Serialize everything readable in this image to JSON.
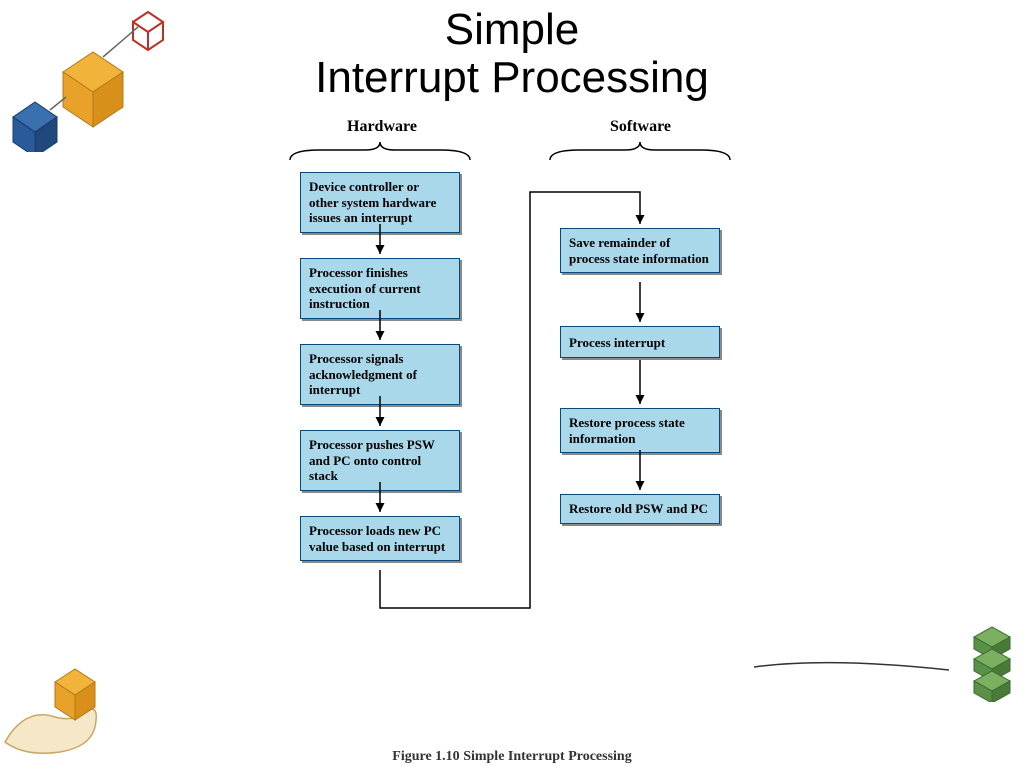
{
  "title_line1": "Simple",
  "title_line2": "Interrupt Processing",
  "headers": {
    "hardware": "Hardware",
    "software": "Software"
  },
  "hardware_steps": [
    "Device controller or other system hardware issues an interrupt",
    "Processor finishes execution of current instruction",
    "Processor signals acknowledgment of interrupt",
    "Processor pushes PSW and PC onto control stack",
    "Processor loads new PC value based on interrupt"
  ],
  "software_steps": [
    "Save remainder of process state information",
    "Process interrupt",
    "Restore process state information",
    "Restore old PSW and PC"
  ],
  "caption_prefix": "Figure 1.10   ",
  "caption_text": "Simple Interrupt Processing"
}
